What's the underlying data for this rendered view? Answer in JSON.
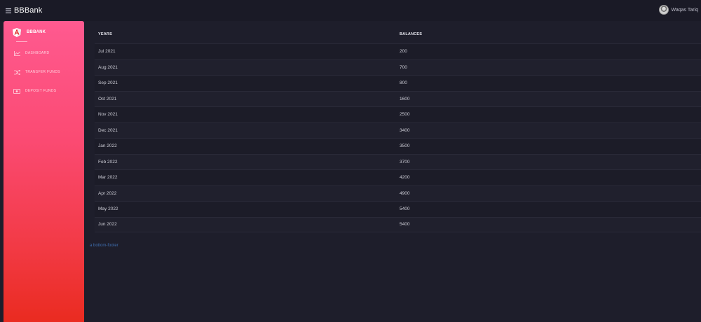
{
  "topbar": {
    "menu_icon": "hamburger-menu-icon",
    "title": "BBBank",
    "user_name": "Waqas Tariq"
  },
  "sidebar": {
    "brand": "BBBANK",
    "logo_icon": "angular-logo-icon",
    "items": [
      {
        "label": "DASHBOARD",
        "icon": "line-chart-icon"
      },
      {
        "label": "TRANSFER FUNDS",
        "icon": "shuffle-icon"
      },
      {
        "label": "DEPOSIT FUNDS",
        "icon": "money-icon"
      }
    ]
  },
  "table": {
    "headers": [
      "YEARS",
      "BALANCES"
    ],
    "rows": [
      [
        "Jul 2021",
        "200"
      ],
      [
        "Aug 2021",
        "700"
      ],
      [
        "Sep 2021",
        "800"
      ],
      [
        "Oct 2021",
        "1600"
      ],
      [
        "Nov 2021",
        "2500"
      ],
      [
        "Dec 2021",
        "3400"
      ],
      [
        "Jan 2022",
        "3500"
      ],
      [
        "Feb 2022",
        "3700"
      ],
      [
        "Mar 2022",
        "4200"
      ],
      [
        "Apr 2022",
        "4900"
      ],
      [
        "May 2022",
        "5400"
      ],
      [
        "Jun 2022",
        "5400"
      ]
    ]
  },
  "footer": {
    "link_text": "a bottom-footer"
  }
}
